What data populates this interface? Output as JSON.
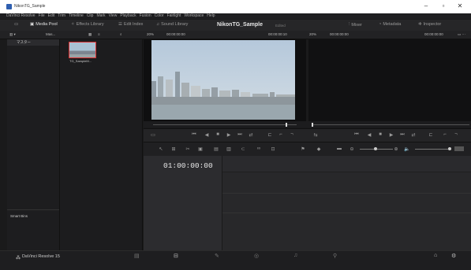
{
  "window": {
    "title": "NikonTG_Sample",
    "min": "–",
    "restore": "▫",
    "close": "✕"
  },
  "menu": [
    "DaVinci Resolve",
    "File",
    "Edit",
    "Trim",
    "Timeline",
    "Clip",
    "Mark",
    "View",
    "Playback",
    "Fusion",
    "Color",
    "Fairlight",
    "Workspace",
    "Help"
  ],
  "toolbar": {
    "media_pool": "Media Pool",
    "effects": "Effects Library",
    "edit_index": "Edit Index",
    "sound_library": "Sound Library",
    "project": "NikonTG_Sample",
    "project_status": "Edited",
    "mixer": "Mixer",
    "metadata": "Metadata",
    "inspector": "Inspector"
  },
  "subbar": {
    "master": "Mas...",
    "zoom_left": "20%",
    "tc_left": "00:00:00:00",
    "duration": "00:00:00:10",
    "zoom_right": "20%",
    "tc_right": "00:00:00:00",
    "tc_right2": "00:00:00:00"
  },
  "bins": {
    "header": "マスター",
    "smart_bins": "Smart Bins"
  },
  "media": {
    "clip_name": "TG_SampleM..."
  },
  "timeline": {
    "timecode": "01:00:00:00"
  },
  "footer": {
    "app": "DaVinci Resolve 15"
  }
}
